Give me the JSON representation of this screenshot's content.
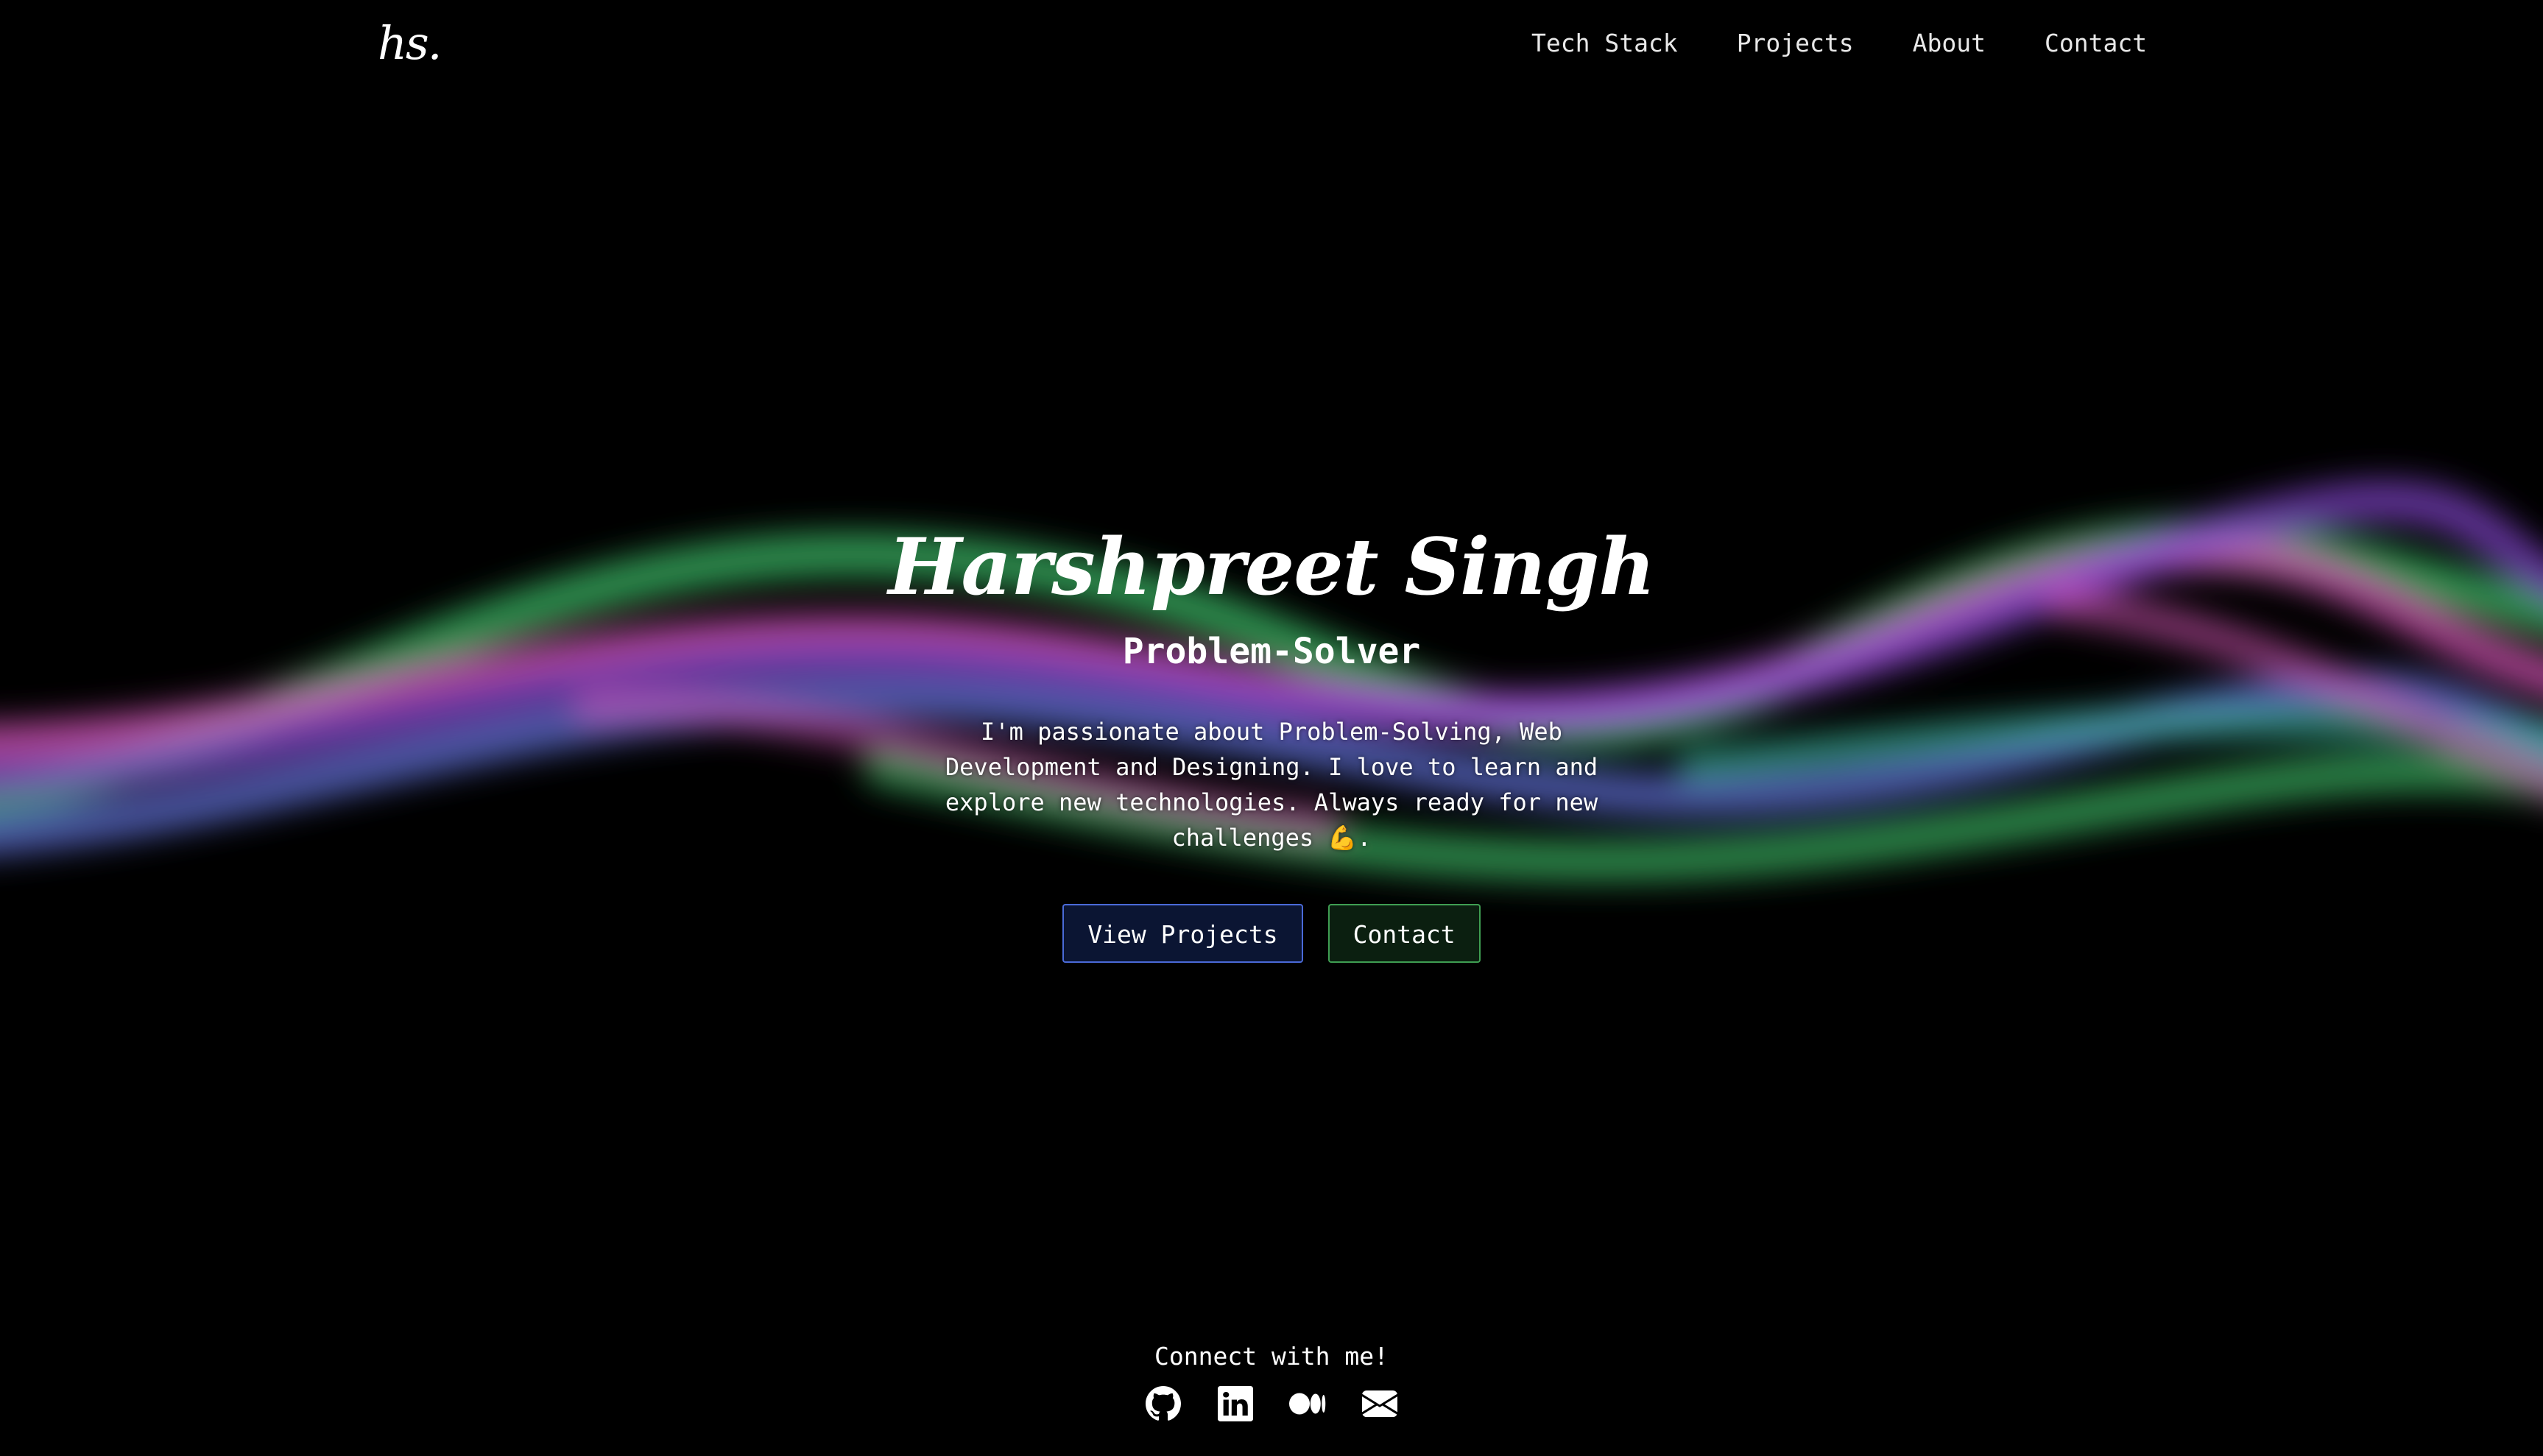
{
  "nav": {
    "logo": "hs.",
    "links": [
      "Tech Stack",
      "Projects",
      "About",
      "Contact"
    ]
  },
  "hero": {
    "name": "Harshpreet Singh",
    "role": "Problem-Solver",
    "description": "I'm passionate about Problem-Solving, Web Development and Designing. I love to learn and explore new technologies. Always ready for new challenges 💪.",
    "buttons": {
      "projects": "View Projects",
      "contact": "Contact"
    }
  },
  "connect": {
    "label": "Connect with me!",
    "icons": [
      "github-icon",
      "linkedin-icon",
      "medium-icon",
      "mail-icon"
    ]
  },
  "colors": {
    "background": "#000000",
    "wave_green": "#3fbf6a",
    "wave_pink": "#e05ac0",
    "wave_blue": "#6a7ae8",
    "wave_purple": "#8a4ad8",
    "wave_teal": "#3fbfa0",
    "projects_border": "#4a6ad8",
    "contact_border": "#3f9e52"
  }
}
